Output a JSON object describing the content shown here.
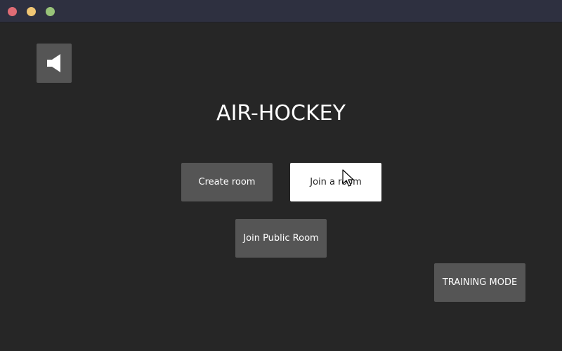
{
  "window": {
    "controls": [
      "close",
      "minimize",
      "maximize"
    ]
  },
  "sound_button": {
    "icon": "speaker-icon"
  },
  "title": "AIR-HOCKEY",
  "buttons": {
    "create_room": "Create room",
    "join_room": "Join a room",
    "join_public_room": "Join Public Room",
    "training_mode": "TRAINING MODE"
  },
  "colors": {
    "background": "#262626",
    "button": "#555555",
    "button_highlight": "#ffffff",
    "titlebar": "#2e3040"
  }
}
